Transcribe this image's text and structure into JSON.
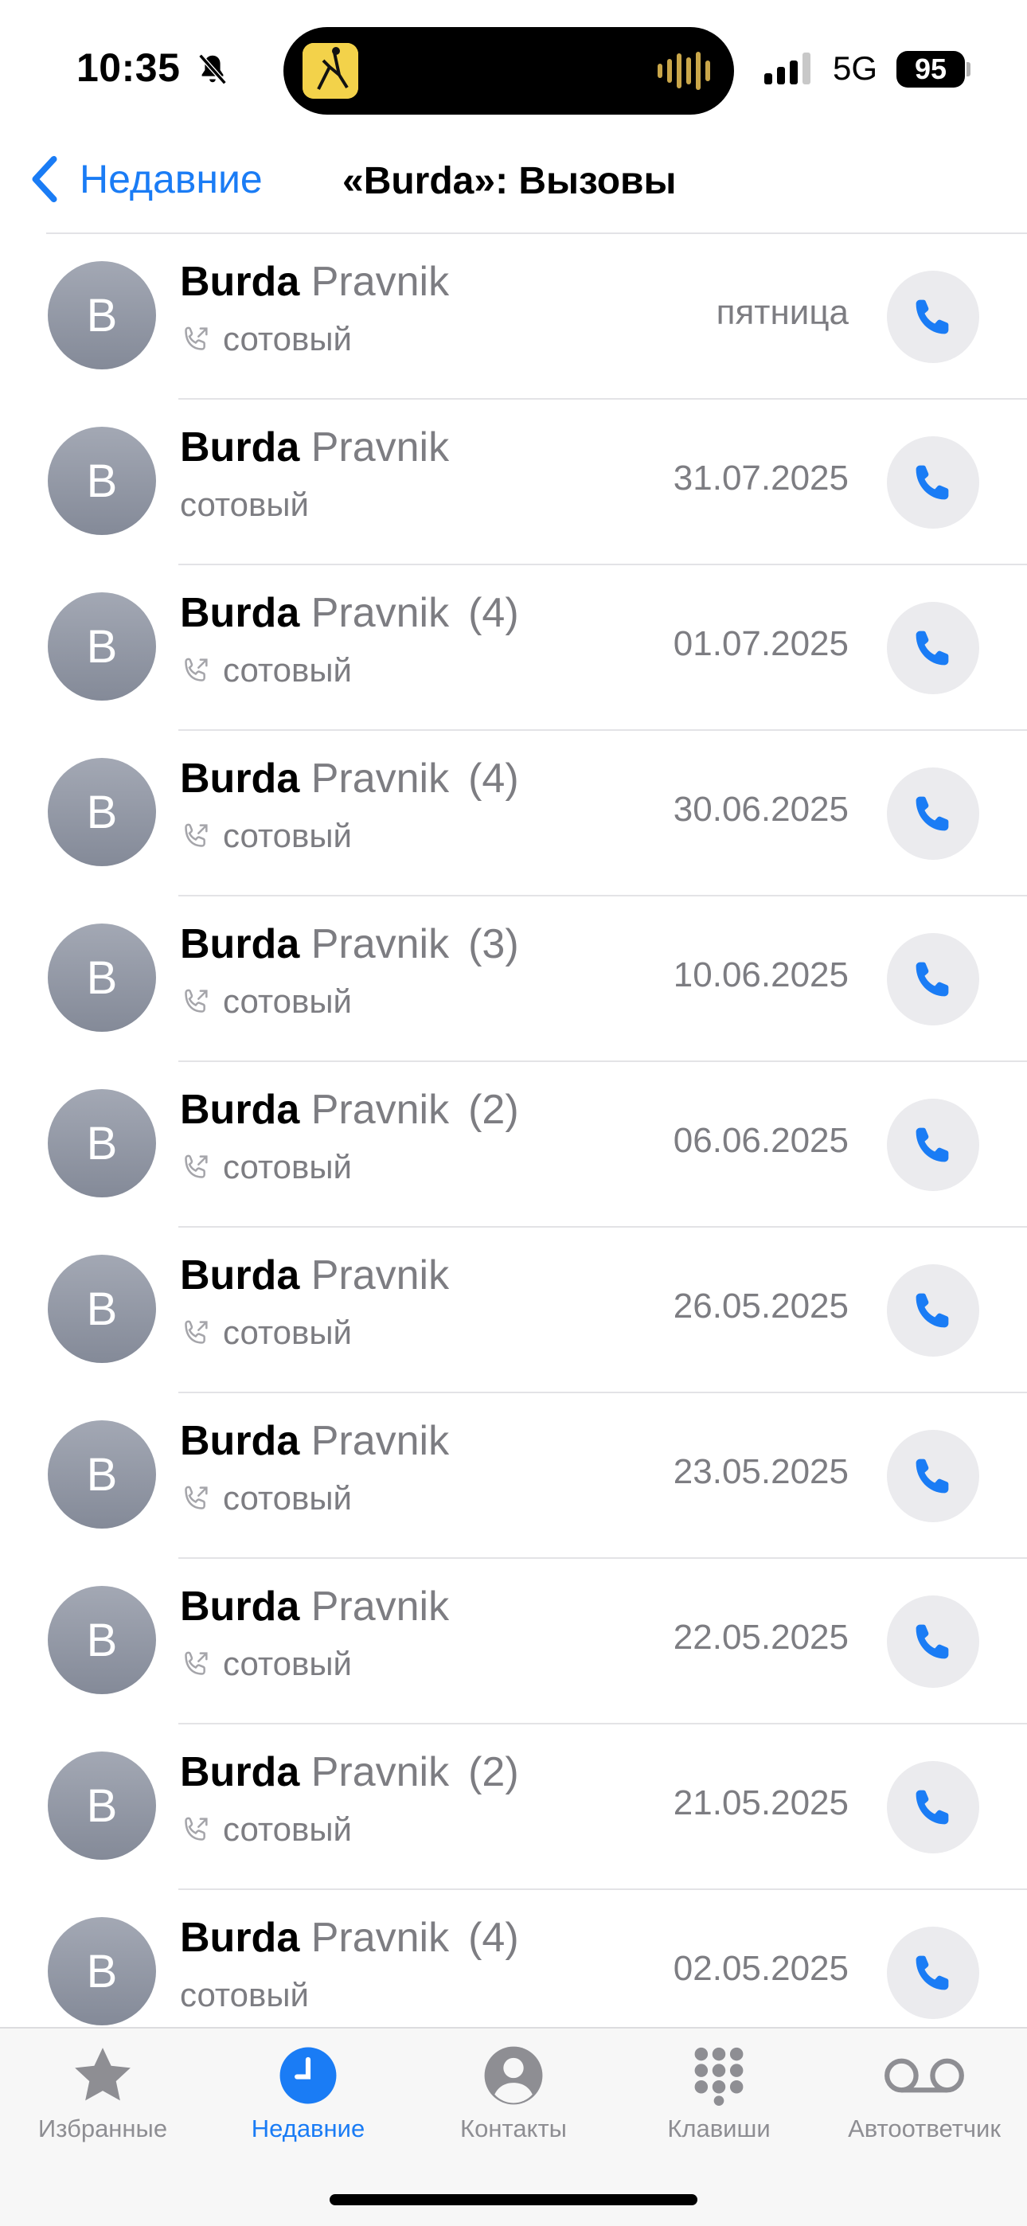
{
  "status_bar": {
    "time": "10:35",
    "network": "5G",
    "battery": "95",
    "bell_icon": "bell-slash-icon"
  },
  "nav": {
    "back_label": "Недавние",
    "title": "«Burda»: Вызовы"
  },
  "calls": [
    {
      "avatar": "B",
      "first": "Burda",
      "last": "Pravnik",
      "count": "",
      "type": "сотовый",
      "outgoing": true,
      "date": "пятница"
    },
    {
      "avatar": "B",
      "first": "Burda",
      "last": "Pravnik",
      "count": "",
      "type": "сотовый",
      "outgoing": false,
      "date": "31.07.2025"
    },
    {
      "avatar": "B",
      "first": "Burda",
      "last": "Pravnik",
      "count": "(4)",
      "type": "сотовый",
      "outgoing": true,
      "date": "01.07.2025"
    },
    {
      "avatar": "B",
      "first": "Burda",
      "last": "Pravnik",
      "count": "(4)",
      "type": "сотовый",
      "outgoing": true,
      "date": "30.06.2025"
    },
    {
      "avatar": "B",
      "first": "Burda",
      "last": "Pravnik",
      "count": "(3)",
      "type": "сотовый",
      "outgoing": true,
      "date": "10.06.2025"
    },
    {
      "avatar": "B",
      "first": "Burda",
      "last": "Pravnik",
      "count": "(2)",
      "type": "сотовый",
      "outgoing": true,
      "date": "06.06.2025"
    },
    {
      "avatar": "B",
      "first": "Burda",
      "last": "Pravnik",
      "count": "",
      "type": "сотовый",
      "outgoing": true,
      "date": "26.05.2025"
    },
    {
      "avatar": "B",
      "first": "Burda",
      "last": "Pravnik",
      "count": "",
      "type": "сотовый",
      "outgoing": true,
      "date": "23.05.2025"
    },
    {
      "avatar": "B",
      "first": "Burda",
      "last": "Pravnik",
      "count": "",
      "type": "сотовый",
      "outgoing": true,
      "date": "22.05.2025"
    },
    {
      "avatar": "B",
      "first": "Burda",
      "last": "Pravnik",
      "count": "(2)",
      "type": "сотовый",
      "outgoing": true,
      "date": "21.05.2025"
    },
    {
      "avatar": "B",
      "first": "Burda",
      "last": "Pravnik",
      "count": "(4)",
      "type": "сотовый",
      "outgoing": false,
      "date": "02.05.2025"
    }
  ],
  "tabbar": {
    "favorites": "Избранные",
    "recents": "Недавние",
    "contacts": "Контакты",
    "keypad": "Клавиши",
    "voicemail": "Автоответчик"
  },
  "colors": {
    "accent": "#1a7cf5",
    "secondary_text": "#7d7d82"
  }
}
